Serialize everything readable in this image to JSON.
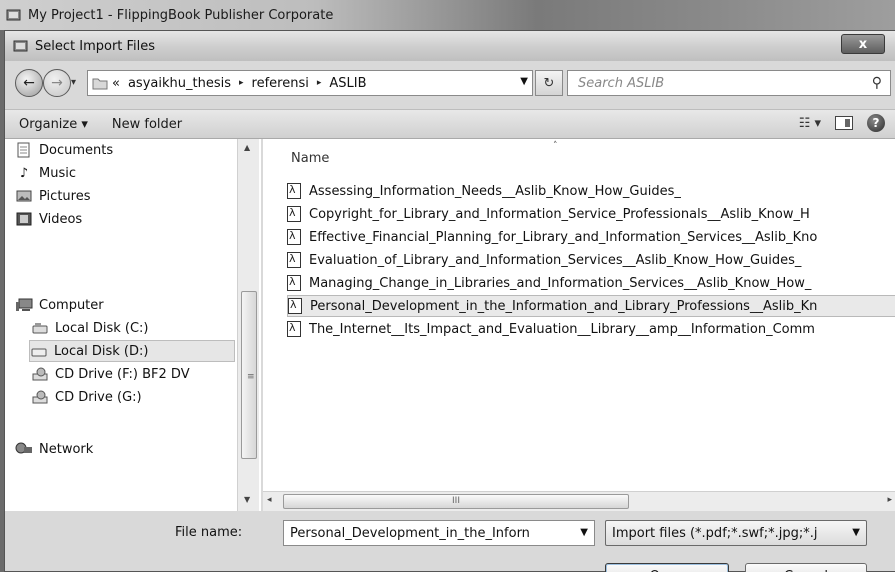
{
  "parent_window": {
    "title": "My Project1 - FlippingBook Publisher Corporate"
  },
  "dialog": {
    "title": "Select Import Files",
    "close_label": "x"
  },
  "address": {
    "recent_glyph": "▾",
    "prefix": "«",
    "crumbs": [
      "asyaikhu_thesis",
      "referensi",
      "ASLIB"
    ],
    "separator": "▸",
    "dropdown_glyph": "▼",
    "refresh_glyph": "↻"
  },
  "search": {
    "placeholder": "Search ASLIB",
    "icon": "search-icon"
  },
  "toolbar": {
    "organize": "Organize ▾",
    "new_folder": "New folder",
    "view_glyph": "☷ ▾",
    "help": "?"
  },
  "nav": {
    "items": [
      {
        "label": "Documents",
        "icon": "document-icon"
      },
      {
        "label": "Music",
        "icon": "music-icon"
      },
      {
        "label": "Pictures",
        "icon": "pictures-icon"
      },
      {
        "label": "Videos",
        "icon": "videos-icon"
      },
      {
        "label": "Computer",
        "icon": "computer-icon"
      },
      {
        "label": "Local Disk (C:)",
        "icon": "disk-icon"
      },
      {
        "label": "Local Disk (D:)",
        "icon": "disk-icon",
        "selected": true
      },
      {
        "label": "CD Drive (F:) BF2 DV",
        "icon": "cd-drive-icon"
      },
      {
        "label": "CD Drive (G:)",
        "icon": "cd-drive-icon"
      },
      {
        "label": "Network",
        "icon": "network-icon"
      }
    ],
    "scroll_up": "▲",
    "scroll_down": "▼",
    "grip": "≡"
  },
  "files": {
    "column": "Name",
    "sort_glyph": "˄",
    "rows": [
      "Assessing_Information_Needs__Aslib_Know_How_Guides_",
      "Copyright_for_Library_and_Information_Service_Professionals__Aslib_Know_H",
      "Effective_Financial_Planning_for_Library_and_Information_Services__Aslib_Kno",
      "Evaluation_of_Library_and_Information_Services__Aslib_Know_How_Guides_",
      "Managing_Change_in_Libraries_and_Information_Services__Aslib_Know_How_",
      "Personal_Development_in_the_Information_and_Library_Professions__Aslib_Kn",
      "The_Internet__Its_Impact_and_Evaluation__Library__amp__Information_Comm"
    ],
    "selected_index": 5
  },
  "hscroll": {
    "left": "◂",
    "right": "▸",
    "grip": "III"
  },
  "bottom": {
    "file_name_label": "File name:",
    "file_name_value": "Personal_Development_in_the_Inforn",
    "file_type_value": "Import files (*.pdf;*.swf;*.jpg;*.j",
    "dropdown_glyph": "▼",
    "open_label": "Open",
    "cancel_label": "Cancel"
  }
}
